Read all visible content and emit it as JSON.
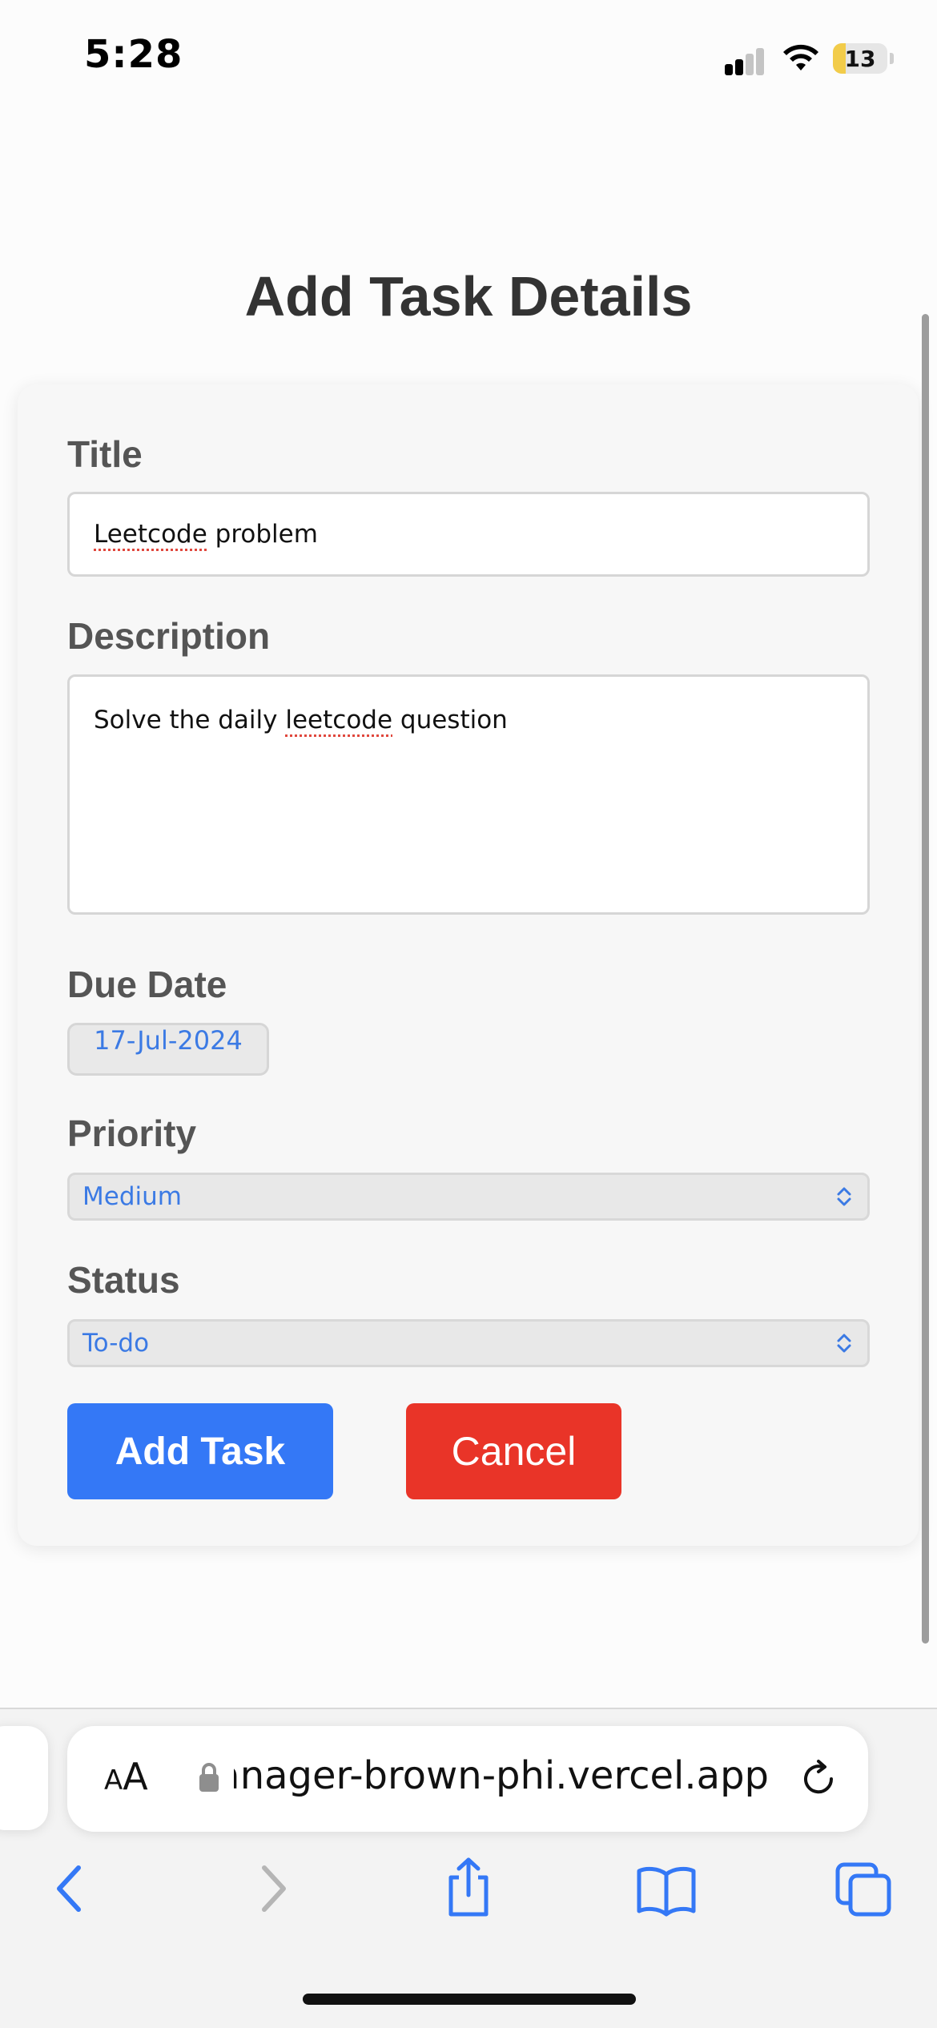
{
  "status_bar": {
    "time": "5:28",
    "battery_level": "13",
    "icons": [
      "cellular-signal-icon",
      "wifi-icon",
      "battery-icon"
    ]
  },
  "page": {
    "title": "Add Task Details"
  },
  "form": {
    "title_label": "Title",
    "title_value_word1": "Leetcode",
    "title_value_rest": " problem",
    "description_label": "Description",
    "description_value_start": "Solve the daily ",
    "description_value_flagged": "leetcode",
    "description_value_end": " question",
    "due_date_label": "Due Date",
    "due_date_value": "17-Jul-2024",
    "priority_label": "Priority",
    "priority_value": "Medium",
    "status_label": "Status",
    "status_value": "To-do",
    "add_button": "Add Task",
    "cancel_button": "Cancel"
  },
  "browser": {
    "text_size_small": "A",
    "text_size_large": "A",
    "url": "anager-brown-phi.vercel.app",
    "icons": [
      "lock-icon",
      "reload-icon",
      "back-icon",
      "forward-icon",
      "share-icon",
      "bookmarks-icon",
      "tabs-icon"
    ]
  },
  "colors": {
    "accent": "#3478f6",
    "danger": "#e93428",
    "link_text": "#3b7ae4",
    "battery_low": "#f2cc4a"
  }
}
